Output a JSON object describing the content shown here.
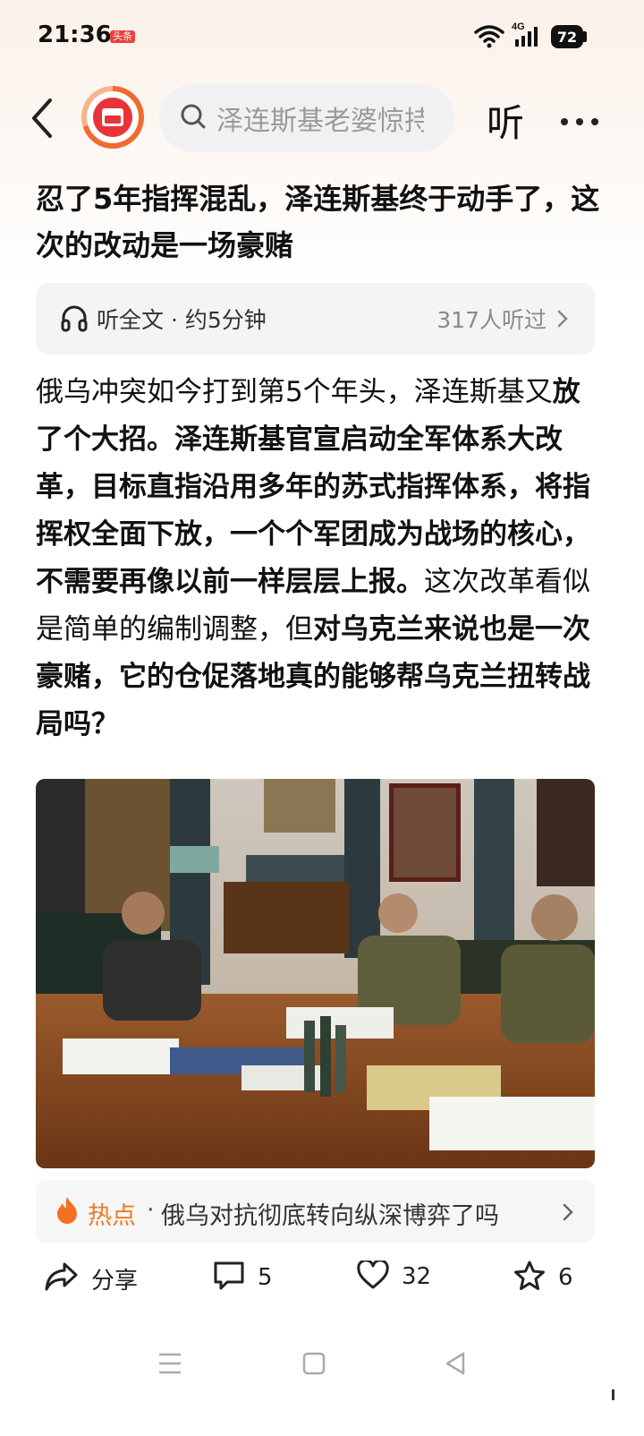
{
  "status_bar": {
    "time": "21:36",
    "app_badge": "头条",
    "network": "4G",
    "battery": "72"
  },
  "nav": {
    "search_placeholder": "泽连斯基老婆惊持",
    "listen_label": "听",
    "icons": [
      "back-icon",
      "app-logo",
      "search-icon",
      "more-icon"
    ]
  },
  "article": {
    "title": "忍了5年指挥混乱，泽连斯基终于动手了，这次的改动是一场豪赌",
    "listen_bar": {
      "label": "听全文 · 约5分钟",
      "count": "317人听过"
    },
    "body_part1": "俄乌冲突如今打到第5个年头，泽连斯基又",
    "body_part2": "放了个大招。泽连斯基官宣启动全军体系大改革，目标直指沿用多年的苏式指挥体系，将指挥权全面下放，一个个军团成为战场的核心，不需要再像以前一样层层上报。",
    "body_part3": "这次改革看似是简单的编制调整，但",
    "body_part4": "对乌克兰来说也是一次豪赌，它的仓促落地真的能够帮乌克兰扭转战局吗？"
  },
  "hot_topic": {
    "tag": "热点",
    "separator": "·",
    "text": "俄乌对抗彻底转向纵深博弈了吗"
  },
  "actions": {
    "share_label": "分享",
    "comments": "5",
    "likes": "32",
    "favorites": "6"
  },
  "colors": {
    "accent": "#f07a20",
    "brand_red": "#e8333a"
  }
}
